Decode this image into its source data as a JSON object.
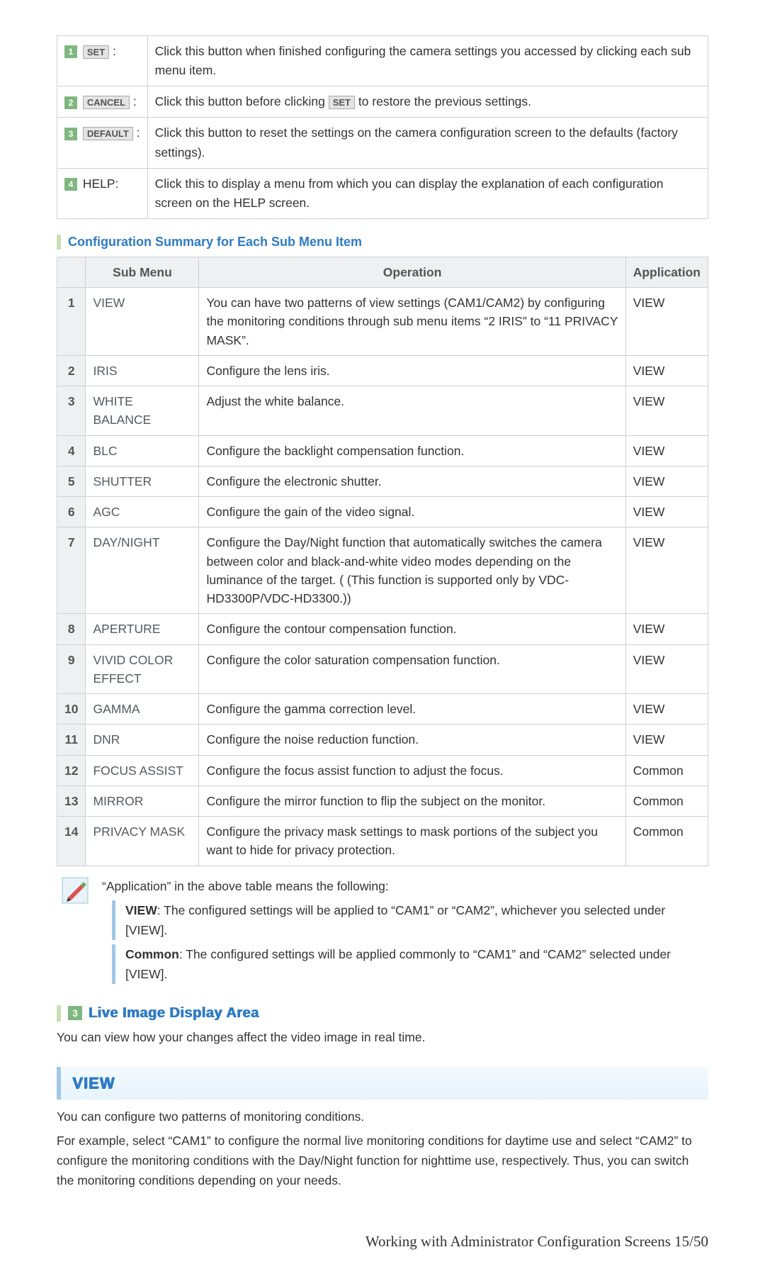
{
  "buttons_table": [
    {
      "num": "1",
      "btn": "SET",
      "desc_before": "Click this button when finished configuring the camera settings you accessed by clicking each sub menu item.",
      "inline_btn": "",
      "desc_after": ""
    },
    {
      "num": "2",
      "btn": "CANCEL",
      "desc_before": "Click this button before clicking ",
      "inline_btn": "SET",
      "desc_after": " to restore the previous settings."
    },
    {
      "num": "3",
      "btn": "DEFAULT",
      "desc_before": "Click this button to reset the settings on the camera configuration screen to the defaults (factory settings).",
      "inline_btn": "",
      "desc_after": ""
    },
    {
      "num": "4",
      "plain": "HELP:",
      "desc_before": "Click this to display a menu from which you can display the explanation of each configuration screen on the HELP screen.",
      "inline_btn": "",
      "desc_after": ""
    }
  ],
  "config_summary_heading": "Configuration Summary for Each Sub Menu Item",
  "summary_headers": {
    "sub": "Sub Menu",
    "op": "Operation",
    "app": "Application"
  },
  "summary_rows": [
    {
      "n": "1",
      "menu": "VIEW",
      "op": "You can have two patterns of view settings (CAM1/CAM2) by configuring the monitoring conditions through sub menu items “2 IRIS” to “11 PRIVACY MASK”.",
      "app": "VIEW"
    },
    {
      "n": "2",
      "menu": "IRIS",
      "op": "Configure the lens iris.",
      "app": "VIEW"
    },
    {
      "n": "3",
      "menu": "WHITE BALANCE",
      "op": "Adjust the white balance.",
      "app": "VIEW"
    },
    {
      "n": "4",
      "menu": "BLC",
      "op": "Configure the backlight compensation function.",
      "app": "VIEW"
    },
    {
      "n": "5",
      "menu": "SHUTTER",
      "op": "Configure the electronic shutter.",
      "app": "VIEW"
    },
    {
      "n": "6",
      "menu": "AGC",
      "op": "Configure the gain of the video signal.",
      "app": "VIEW"
    },
    {
      "n": "7",
      "menu": "DAY/NIGHT",
      "op": "Configure the Day/Night function that automatically switches the camera between color and black-and-white video modes depending on the luminance of the target. ( (This function is supported only by VDC-HD3300P/VDC-HD3300.))",
      "app": "VIEW"
    },
    {
      "n": "8",
      "menu": "APERTURE",
      "op": "Configure the contour compensation function.",
      "app": "VIEW"
    },
    {
      "n": "9",
      "menu": "VIVID COLOR EFFECT",
      "op": "Configure the color saturation compensation function.",
      "app": "VIEW"
    },
    {
      "n": "10",
      "menu": "GAMMA",
      "op": "Configure the gamma correction level.",
      "app": "VIEW"
    },
    {
      "n": "11",
      "menu": "DNR",
      "op": "Configure the noise reduction function.",
      "app": "VIEW"
    },
    {
      "n": "12",
      "menu": "FOCUS ASSIST",
      "op": "Configure the focus assist function to adjust the focus.",
      "app": "Common"
    },
    {
      "n": "13",
      "menu": "MIRROR",
      "op": "Configure the mirror function to flip the subject on the monitor.",
      "app": "Common"
    },
    {
      "n": "14",
      "menu": "PRIVACY MASK",
      "op": "Configure the privacy mask settings to mask portions of the subject you want to hide for privacy protection.",
      "app": "Common"
    }
  ],
  "note": {
    "intro": "“Application” in the above table means the following:",
    "view_label": "VIEW",
    "view_text": ": The configured settings will be applied to “CAM1” or “CAM2”, whichever you selected under [VIEW].",
    "common_label": "Common",
    "common_text": ": The configured settings will be applied commonly to “CAM1” and “CAM2” selected under [VIEW]."
  },
  "live_section": {
    "num": "3",
    "title": "Live Image Display Area",
    "body": "You can view how your changes affect the video image in real time."
  },
  "view_section": {
    "title": "VIEW",
    "p1": "You can configure two patterns of monitoring conditions.",
    "p2": "For example, select “CAM1” to configure the normal live monitoring conditions for daytime use and select “CAM2” to configure the monitoring conditions with the Day/Night function for nighttime use, respectively. Thus, you can switch the monitoring conditions depending on your needs."
  },
  "footer": "Working with Administrator Configuration Screens 15/50"
}
